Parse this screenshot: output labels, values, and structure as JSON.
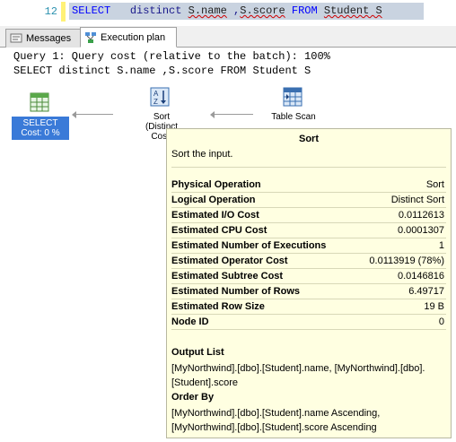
{
  "editor": {
    "line_number": "12",
    "code_kw": "SELECT",
    "code_mid": "   distinct ",
    "code_s1": "S.name",
    "code_mid2": " ,",
    "code_s2": "S.score",
    "code_rest_kw": " FROM ",
    "code_table": "Student S"
  },
  "tabs": [
    {
      "label": "Messages",
      "active": false,
      "icon": "messages-icon"
    },
    {
      "label": "Execution plan",
      "active": true,
      "icon": "execution-plan-icon"
    }
  ],
  "plan": {
    "header_line1": "Query 1: Query cost (relative to the batch): 100%",
    "header_line2": "SELECT distinct S.name ,S.score FROM Student S",
    "nodes": {
      "select": {
        "label": "SELECT\nCost: 0 %",
        "icon": "select-result-icon"
      },
      "sort": {
        "label": "Sort\n(Distinct\nCost:",
        "icon": "sort-icon"
      },
      "table_scan": {
        "label": "Table Scan",
        "icon": "table-scan-icon"
      }
    }
  },
  "tooltip": {
    "title": "Sort",
    "description": "Sort the input.",
    "properties": [
      {
        "key": "Physical Operation",
        "value": "Sort"
      },
      {
        "key": "Logical Operation",
        "value": "Distinct Sort"
      },
      {
        "key": "Estimated I/O Cost",
        "value": "0.0112613"
      },
      {
        "key": "Estimated CPU Cost",
        "value": "0.0001307"
      },
      {
        "key": "Estimated Number of Executions",
        "value": "1"
      },
      {
        "key": "Estimated Operator Cost",
        "value": "0.0113919 (78%)"
      },
      {
        "key": "Estimated Subtree Cost",
        "value": "0.0146816"
      },
      {
        "key": "Estimated Number of Rows",
        "value": "6.49717"
      },
      {
        "key": "Estimated Row Size",
        "value": "19 B"
      },
      {
        "key": "Node ID",
        "value": "0"
      }
    ],
    "output_list_heading": "Output List",
    "output_list": "[MyNorthwind].[dbo].[Student].name, [MyNorthwind].[dbo].[Student].score",
    "order_by_heading": "Order By",
    "order_by": "[MyNorthwind].[dbo].[Student].name Ascending, [MyNorthwind].[dbo].[Student].score Ascending"
  },
  "colors": {
    "selected_node_bg": "#3a7ad8",
    "tooltip_bg": "#ffffe1",
    "code_highlight": "#c9d3e0",
    "line_number": "#2b91af"
  }
}
